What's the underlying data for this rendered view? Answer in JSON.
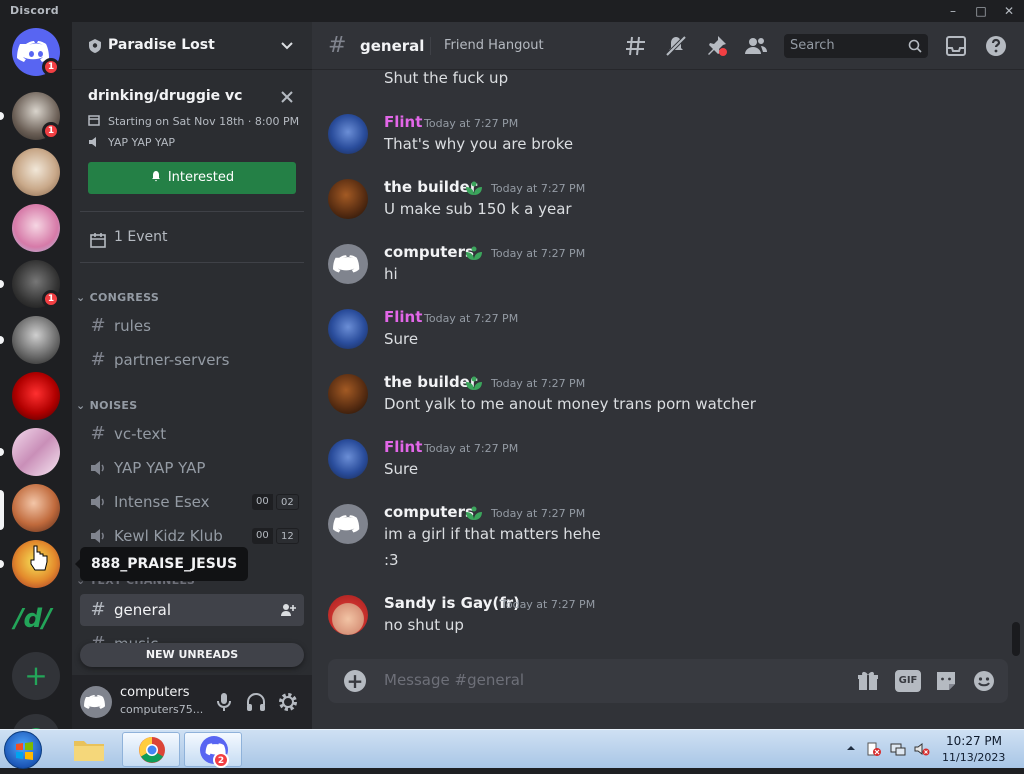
{
  "window": {
    "title": "Discord",
    "controls": [
      "–",
      "□",
      "✕"
    ]
  },
  "servers": {
    "dm_badge": "1",
    "badges": [
      "1",
      "1"
    ],
    "tooltip": "888_PRAISE_JESUS",
    "add_label": "+",
    "logo_text": "/d/"
  },
  "guild": {
    "name": "Paradise Lost"
  },
  "event": {
    "title": "drinking/druggie vc",
    "start": "Starting on Sat Nov 18th · 8:00 PM",
    "location": "YAP YAP YAP",
    "button": "Interested",
    "events_label": "1 Event"
  },
  "categories": {
    "congress": "CONGRESS",
    "noises": "NOISES",
    "text": "TEXT CHANNELS"
  },
  "channels": {
    "rules": "rules",
    "partner": "partner-servers",
    "vc_text": "vc-text",
    "yap": "YAP YAP YAP",
    "intense": "Intense Esex",
    "intense_c1": "00",
    "intense_c2": "02",
    "kewl": "Kewl Kidz Klub",
    "kewl_c1": "00",
    "kewl_c2": "12",
    "general": "general",
    "music": "music"
  },
  "new_unreads": "NEW UNREADS",
  "user": {
    "name": "computers",
    "tag": "computers75..."
  },
  "topbar": {
    "channel": "general",
    "topic": "Friend Hangout",
    "search_placeholder": "Search"
  },
  "messages": {
    "top_line": "Shut the fuck up",
    "m1": {
      "author": "Flint",
      "time": "Today at 7:27 PM",
      "text": "That's why you are broke"
    },
    "m2": {
      "author": "the builder",
      "time": "Today at 7:27 PM",
      "text": "U make sub 150 k a year"
    },
    "m3": {
      "author": "computers",
      "time": "Today at 7:27 PM",
      "text": "hi"
    },
    "m4": {
      "author": "Flint",
      "time": "Today at 7:27 PM",
      "text": "Sure"
    },
    "m5": {
      "author": "the builder",
      "time": "Today at 7:27 PM",
      "text": "Dont yalk to me anout money trans porn watcher"
    },
    "m6": {
      "author": "Flint",
      "time": "Today at 7:27 PM",
      "text": "Sure"
    },
    "m7": {
      "author": "computers",
      "time": "Today at 7:27 PM",
      "text": "im a girl if that matters hehe",
      "text2": ":3"
    },
    "m8": {
      "author": "Sandy is Gay(fr)",
      "time": "Today at 7:27 PM",
      "text": "no shut up"
    }
  },
  "composer": {
    "placeholder": "Message #general",
    "gif": "GIF"
  },
  "colors": {
    "flint": "#e267e8",
    "accent_green": "#248046",
    "blurple": "#5865f2"
  },
  "taskbar": {
    "time": "10:27 PM",
    "date": "11/13/2023",
    "discord_badge": "2"
  }
}
